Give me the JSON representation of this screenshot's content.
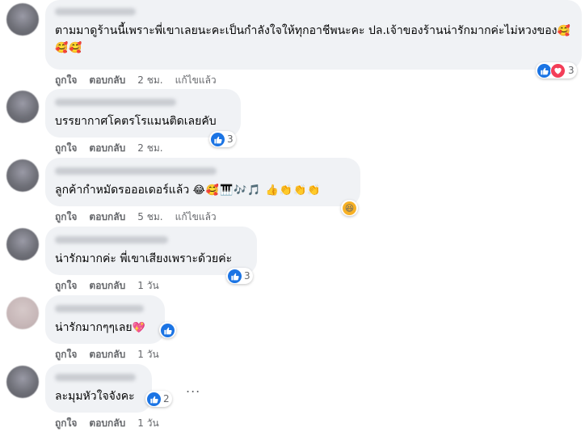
{
  "comments": [
    {
      "text": "ตามมาดูร้านนี้เพราะพี่เขาเลยนะคะเป็นกำลังใจให้ทุกอาชีพนะคะ ปล.เจ้าของร้านน่ารักมากค่ะไม่หวงของ",
      "emoji": "🥰🥰🥰",
      "like": "ถูกใจ",
      "reply": "ตอบกลับ",
      "time": "2 ชม.",
      "edited": "แก้ไขแล้ว",
      "reaction_count": "3"
    },
    {
      "text": "บรรยากาศโคตรโรแมนติดเลยคับ",
      "emoji": "",
      "like": "ถูกใจ",
      "reply": "ตอบกลับ",
      "time": "2 ชม.",
      "edited": "",
      "reaction_count": "3"
    },
    {
      "text": "ลูกค้ากำหมัดรอออเดอร์แล้ว",
      "emoji": "😂🥰🎹🎶🎵 👍👏👏👏",
      "like": "ถูกใจ",
      "reply": "ตอบกลับ",
      "time": "5 ชม.",
      "edited": "แก้ไขแล้ว",
      "reaction_count": ""
    },
    {
      "text": "น่ารักมากค่ะ พี่เขาเสียงเพราะด้วยค่ะ",
      "emoji": "",
      "like": "ถูกใจ",
      "reply": "ตอบกลับ",
      "time": "1 วัน",
      "edited": "",
      "reaction_count": "3"
    },
    {
      "text": "น่ารักมากๆๆเลย",
      "emoji": "💖",
      "like": "ถูกใจ",
      "reply": "ตอบกลับ",
      "time": "1 วัน",
      "edited": "",
      "reaction_count": ""
    },
    {
      "text": "ละมุมหัวใจจังคะ",
      "emoji": "",
      "like": "ถูกใจ",
      "reply": "ตอบกลับ",
      "time": "1 วัน",
      "edited": "",
      "reaction_count": "2"
    }
  ],
  "more_options": "...",
  "icons": {
    "like": "like-icon",
    "love": "love-icon",
    "haha": "haha-icon",
    "more": "more-options-icon"
  },
  "colors": {
    "like": "#1b74e4",
    "love": "#f33e58",
    "haha": "#f7b125",
    "bubble": "#f0f2f5",
    "meta": "#65676b"
  }
}
